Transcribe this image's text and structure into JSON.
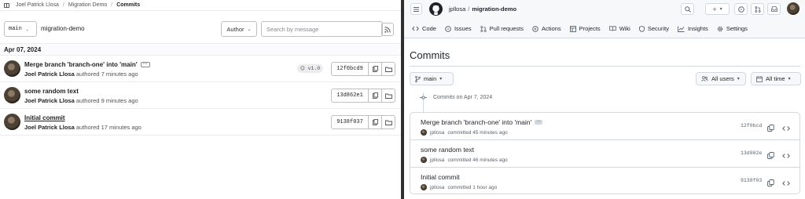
{
  "gitlab": {
    "breadcrumb": [
      "Joel Patrick Llosa",
      "Migration Demo",
      "Commits"
    ],
    "branch": "main",
    "project": "migration-demo",
    "author_filter": "Author",
    "search_placeholder": "Search by message",
    "date_header": "Apr 07, 2024",
    "commits": [
      {
        "title": "Merge branch 'branch-one' into 'main'",
        "author": "Joel Patrick Llosa",
        "meta": "authored 7 minutes ago",
        "tag": "v1.0",
        "sha": "12f0bcd9"
      },
      {
        "title": "some random text",
        "author": "Joel Patrick Llosa",
        "meta": "authored 9 minutes ago",
        "sha": "13d862e1"
      },
      {
        "title": "Initial commit",
        "author": "Joel Patrick Llosa",
        "meta": "authored 17 minutes ago",
        "sha": "9138f037"
      }
    ]
  },
  "github": {
    "owner": "jpllosa",
    "repo": "migration-demo",
    "tabs": [
      "Code",
      "Issues",
      "Pull requests",
      "Actions",
      "Projects",
      "Wiki",
      "Security",
      "Insights",
      "Settings"
    ],
    "page_title": "Commits",
    "branch": "main",
    "users_filter": "All users",
    "time_filter": "All time",
    "date_line": "Commits on Apr 7, 2024",
    "commits": [
      {
        "title": "Merge branch 'branch-one' into 'main'",
        "author": "jpllosa",
        "meta": "committed 45 minutes ago",
        "sha": "12f0bcd"
      },
      {
        "title": "some random text",
        "author": "jpllosa",
        "meta": "committed 46 minutes ago",
        "sha": "13d862e"
      },
      {
        "title": "Initial commit",
        "author": "jpllosa",
        "meta": "committed 1 hour ago",
        "sha": "9138f03"
      }
    ]
  }
}
